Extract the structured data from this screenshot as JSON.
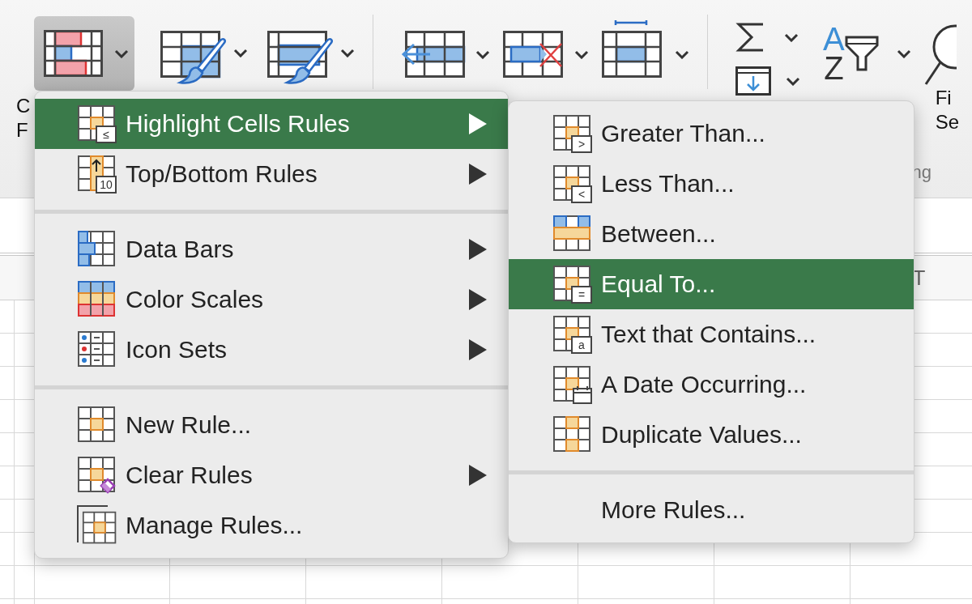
{
  "ribbon": {
    "conditional_formatting": {
      "pressed": true,
      "label_lines": [
        "C",
        "F"
      ]
    },
    "sort_filter": {
      "letters": [
        "A",
        "Z"
      ]
    },
    "find_select": {
      "label_lines": [
        "Fi",
        "Se"
      ]
    },
    "group_label": "ng"
  },
  "menu": {
    "items": [
      {
        "kind": "item",
        "label": "Highlight Cells Rules",
        "badge": "≤",
        "submenu": true,
        "selected": true
      },
      {
        "kind": "item",
        "label": "Top/Bottom Rules",
        "badge": "10",
        "submenu": true,
        "selected": false
      },
      {
        "kind": "separator"
      },
      {
        "kind": "item",
        "label": "Data Bars",
        "submenu": true,
        "selected": false
      },
      {
        "kind": "item",
        "label": "Color Scales",
        "submenu": true,
        "selected": false
      },
      {
        "kind": "item",
        "label": "Icon Sets",
        "submenu": true,
        "selected": false
      },
      {
        "kind": "separator"
      },
      {
        "kind": "item",
        "label": "New Rule...",
        "submenu": false,
        "selected": false
      },
      {
        "kind": "item",
        "label": "Clear Rules",
        "submenu": true,
        "selected": false
      },
      {
        "kind": "item",
        "label": "Manage Rules...",
        "submenu": false,
        "selected": false
      }
    ]
  },
  "submenu": {
    "items": [
      {
        "kind": "item",
        "label": "Greater Than...",
        "badge": ">",
        "submenu": false,
        "selected": false
      },
      {
        "kind": "item",
        "label": "Less Than...",
        "badge": "<",
        "submenu": false,
        "selected": false
      },
      {
        "kind": "item",
        "label": "Between...",
        "submenu": false,
        "selected": false
      },
      {
        "kind": "item",
        "label": "Equal To...",
        "badge": "=",
        "submenu": false,
        "selected": true
      },
      {
        "kind": "item",
        "label": "Text that Contains...",
        "badge": "a",
        "submenu": false,
        "selected": false
      },
      {
        "kind": "item",
        "label": "A Date Occurring...",
        "submenu": false,
        "selected": false
      },
      {
        "kind": "item",
        "label": "Duplicate Values...",
        "submenu": false,
        "selected": false
      },
      {
        "kind": "separator"
      },
      {
        "kind": "item",
        "label": "More Rules...",
        "submenu": false,
        "selected": false
      }
    ]
  },
  "sheet": {
    "column_header": "T"
  }
}
